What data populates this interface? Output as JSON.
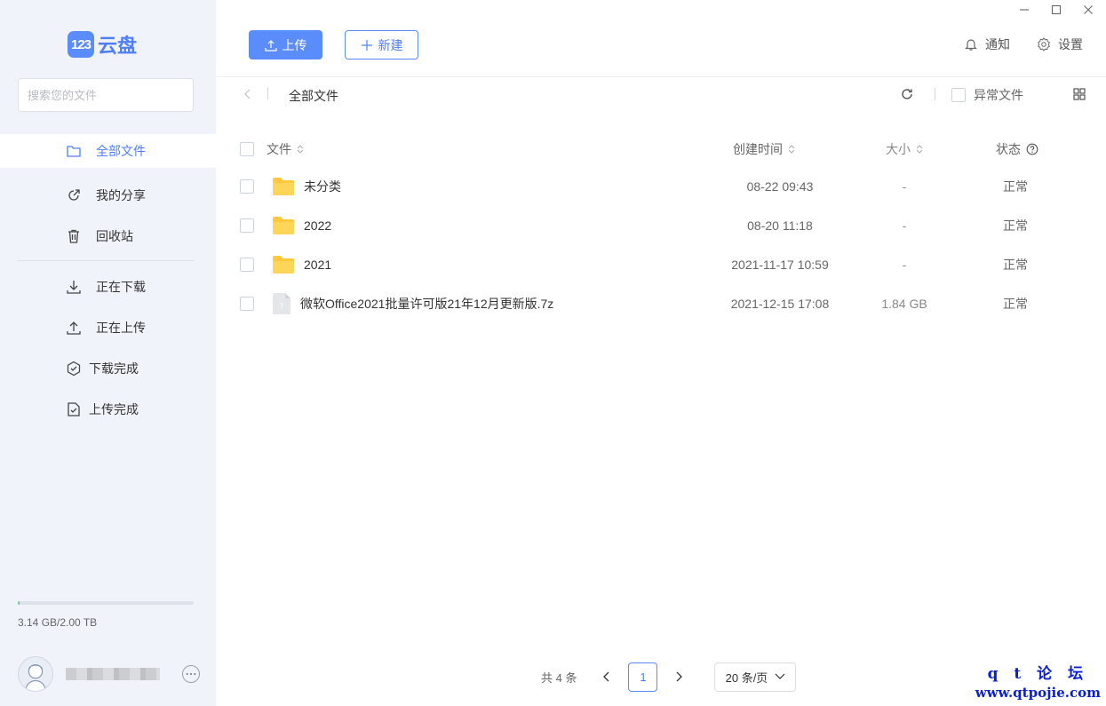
{
  "app": {
    "logo_badge": "123",
    "logo_text": "云盘",
    "accent": "#5b8cfb"
  },
  "search": {
    "placeholder": "搜索您的文件"
  },
  "sidebar": {
    "items": [
      {
        "label": "全部文件",
        "icon": "folder-icon"
      },
      {
        "label": "我的分享",
        "icon": "share-icon"
      },
      {
        "label": "回收站",
        "icon": "trash-icon"
      }
    ],
    "transfer_items": [
      {
        "label": "正在下载",
        "icon": "download-icon"
      },
      {
        "label": "正在上传",
        "icon": "upload-icon"
      },
      {
        "label": "下载完成",
        "icon": "download-done-icon"
      },
      {
        "label": "上传完成",
        "icon": "upload-done-icon"
      }
    ],
    "storage_text": "3.14 GB/2.00 TB",
    "storage_used_fraction": 0.0015
  },
  "toolbar": {
    "upload_label": "上传",
    "new_label": "新建",
    "notify_label": "通知",
    "settings_label": "设置"
  },
  "breadcrumb": {
    "current": "全部文件",
    "abnormal_label": "异常文件"
  },
  "table": {
    "headers": {
      "name": "文件",
      "time": "创建时间",
      "size": "大小",
      "status": "状态"
    },
    "rows": [
      {
        "type": "folder",
        "name": "未分类",
        "time": "08-22 09:43",
        "size": "-",
        "status": "正常"
      },
      {
        "type": "folder",
        "name": "2022",
        "time": "08-20 11:18",
        "size": "-",
        "status": "正常"
      },
      {
        "type": "folder",
        "name": "2021",
        "time": "2021-11-17 10:59",
        "size": "-",
        "status": "正常"
      },
      {
        "type": "file",
        "name": "微软Office2021批量许可版21年12月更新版.7z",
        "time": "2021-12-15 17:08",
        "size": "1.84 GB",
        "status": "正常"
      }
    ]
  },
  "pager": {
    "total": "共 4 条",
    "current_page": "1",
    "page_size": "20 条/页"
  },
  "watermark": {
    "line1": "q t 论 坛",
    "line2": "www.qtpojie.com"
  }
}
